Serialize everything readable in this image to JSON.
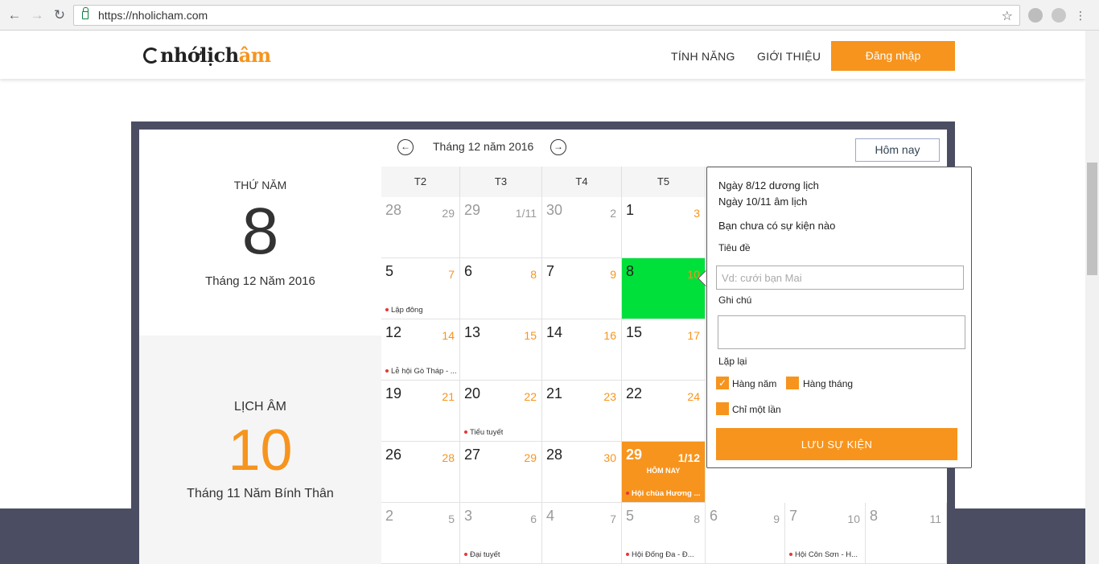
{
  "browser": {
    "url": "https://nholicham.com",
    "back_icon": "arrow-left-icon",
    "forward_icon": "arrow-right-icon",
    "reload_icon": "reload-icon",
    "star_icon": "star-icon"
  },
  "header": {
    "logo_text": "nhớlịch",
    "logo_accent": "âm",
    "nav": [
      "TÍNH NĂNG",
      "GIỚI THIỆU"
    ],
    "login_label": "Đăng nhập",
    "accent_color": "#f7941d"
  },
  "left_panel": {
    "weekday": "THỨ NĂM",
    "solar_day": "8",
    "solar_month_year": "Tháng 12 Năm 2016",
    "lunar_title": "LỊCH ÂM",
    "lunar_day": "10",
    "lunar_month_year": "Tháng 11 Năm Bính Thân"
  },
  "calendar": {
    "month_title": "Tháng 12 năm 2016",
    "prev_label": "←",
    "next_label": "→",
    "today_button": "Hôm nay",
    "weekday_headers": [
      "T2",
      "T3",
      "T4",
      "T5"
    ],
    "today_label": "HÔM NAY",
    "rows": [
      [
        {
          "solar": "28",
          "lunar": "29",
          "other": true
        },
        {
          "solar": "29",
          "lunar": "1/11",
          "other": true
        },
        {
          "solar": "30",
          "lunar": "2",
          "other": true
        },
        {
          "solar": "1",
          "lunar": "3"
        }
      ],
      [
        {
          "solar": "5",
          "lunar": "7",
          "event": "Lập đông"
        },
        {
          "solar": "6",
          "lunar": "8"
        },
        {
          "solar": "7",
          "lunar": "9"
        },
        {
          "solar": "8",
          "lunar": "10",
          "selected": true
        }
      ],
      [
        {
          "solar": "12",
          "lunar": "14",
          "event": "Lễ hội Gò Tháp - ..."
        },
        {
          "solar": "13",
          "lunar": "15"
        },
        {
          "solar": "14",
          "lunar": "16"
        },
        {
          "solar": "15",
          "lunar": "17"
        }
      ],
      [
        {
          "solar": "19",
          "lunar": "21"
        },
        {
          "solar": "20",
          "lunar": "22",
          "event": "Tiểu tuyết"
        },
        {
          "solar": "21",
          "lunar": "23"
        },
        {
          "solar": "22",
          "lunar": "24"
        }
      ],
      [
        {
          "solar": "26",
          "lunar": "28"
        },
        {
          "solar": "27",
          "lunar": "29"
        },
        {
          "solar": "28",
          "lunar": "30"
        },
        {
          "solar": "29",
          "lunar": "1/12",
          "today": true,
          "event": "Hội chùa Hương ..."
        }
      ],
      [
        {
          "solar": "2",
          "lunar": "5",
          "other": true
        },
        {
          "solar": "3",
          "lunar": "6",
          "other": true,
          "event": "Đại tuyết"
        },
        {
          "solar": "4",
          "lunar": "7",
          "other": true
        },
        {
          "solar": "5",
          "lunar": "8",
          "other": true,
          "event": "Hội Đống Đa - Đ..."
        },
        {
          "solar": "6",
          "lunar": "9",
          "other": true
        },
        {
          "solar": "7",
          "lunar": "10",
          "other": true,
          "event": "Hội Côn Sơn - H..."
        },
        {
          "solar": "8",
          "lunar": "11",
          "other": true
        }
      ]
    ]
  },
  "popup": {
    "solar_line": "Ngày 8/12 dương lịch",
    "lunar_line": "Ngày 10/11 âm lịch",
    "no_event": "Bạn chưa có sự kiện nào",
    "title_label": "Tiêu đề",
    "title_placeholder": "Vd: cưới bạn Mai",
    "note_label": "Ghi chú",
    "repeat_label": "Lặp lại",
    "opt_yearly": "Hàng năm",
    "opt_monthly": "Hàng tháng",
    "opt_once": "Chỉ một lần",
    "save_label": "LƯU SỰ KIỆN"
  }
}
